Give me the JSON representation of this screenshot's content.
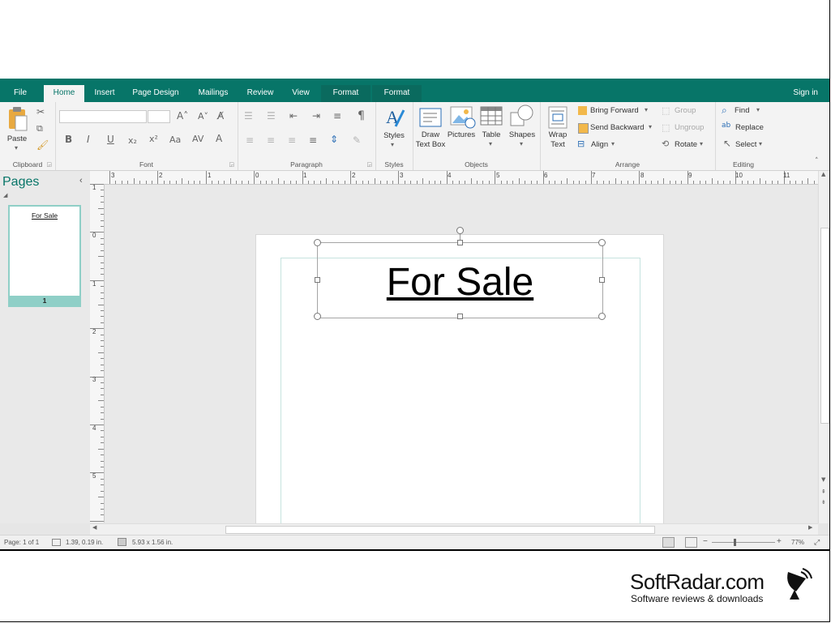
{
  "tabs": {
    "file": "File",
    "home": "Home",
    "insert": "Insert",
    "page_design": "Page Design",
    "mailings": "Mailings",
    "review": "Review",
    "view": "View",
    "format1": "Format",
    "format2": "Format",
    "sign_in": "Sign in"
  },
  "ribbon": {
    "clipboard": {
      "paste": "Paste",
      "label": "Clipboard"
    },
    "font": {
      "label": "Font"
    },
    "paragraph": {
      "label": "Paragraph"
    },
    "styles": {
      "button": "Styles",
      "label": "Styles"
    },
    "objects": {
      "draw_text_box_1": "Draw",
      "draw_text_box_2": "Text Box",
      "pictures": "Pictures",
      "table": "Table",
      "shapes": "Shapes",
      "label": "Objects"
    },
    "arrange": {
      "wrap_text_1": "Wrap",
      "wrap_text_2": "Text",
      "bring_forward": "Bring Forward",
      "send_backward": "Send Backward",
      "align": "Align",
      "group": "Group",
      "ungroup": "Ungroup",
      "rotate": "Rotate",
      "label": "Arrange"
    },
    "editing": {
      "find": "Find",
      "replace": "Replace",
      "select": "Select",
      "label": "Editing"
    }
  },
  "pages_pane": {
    "title": "Pages",
    "thumbnail_title": "For Sale",
    "thumbnail_number": "1"
  },
  "rulers": {
    "horizontal": [
      "3",
      "2",
      "1",
      "0",
      "1",
      "2",
      "3",
      "4",
      "5",
      "6",
      "7",
      "8",
      "9",
      "10",
      "11"
    ],
    "vertical": [
      "1",
      "0",
      "1",
      "2",
      "3",
      "4",
      "5"
    ]
  },
  "document": {
    "textbox_text": "For Sale"
  },
  "status": {
    "page": "Page: 1 of 1",
    "position": "1.39, 0.19 in.",
    "size": "5.93 x 1.56 in.",
    "zoom": "77%"
  },
  "watermark": {
    "name": "SoftRadar.com",
    "tagline": "Software reviews & downloads"
  },
  "colors": {
    "accent": "#077568",
    "ribbon_bg": "#f3f3f3",
    "workspace_bg": "#e9e9e9",
    "thumb_accent": "#8fcfc7"
  }
}
